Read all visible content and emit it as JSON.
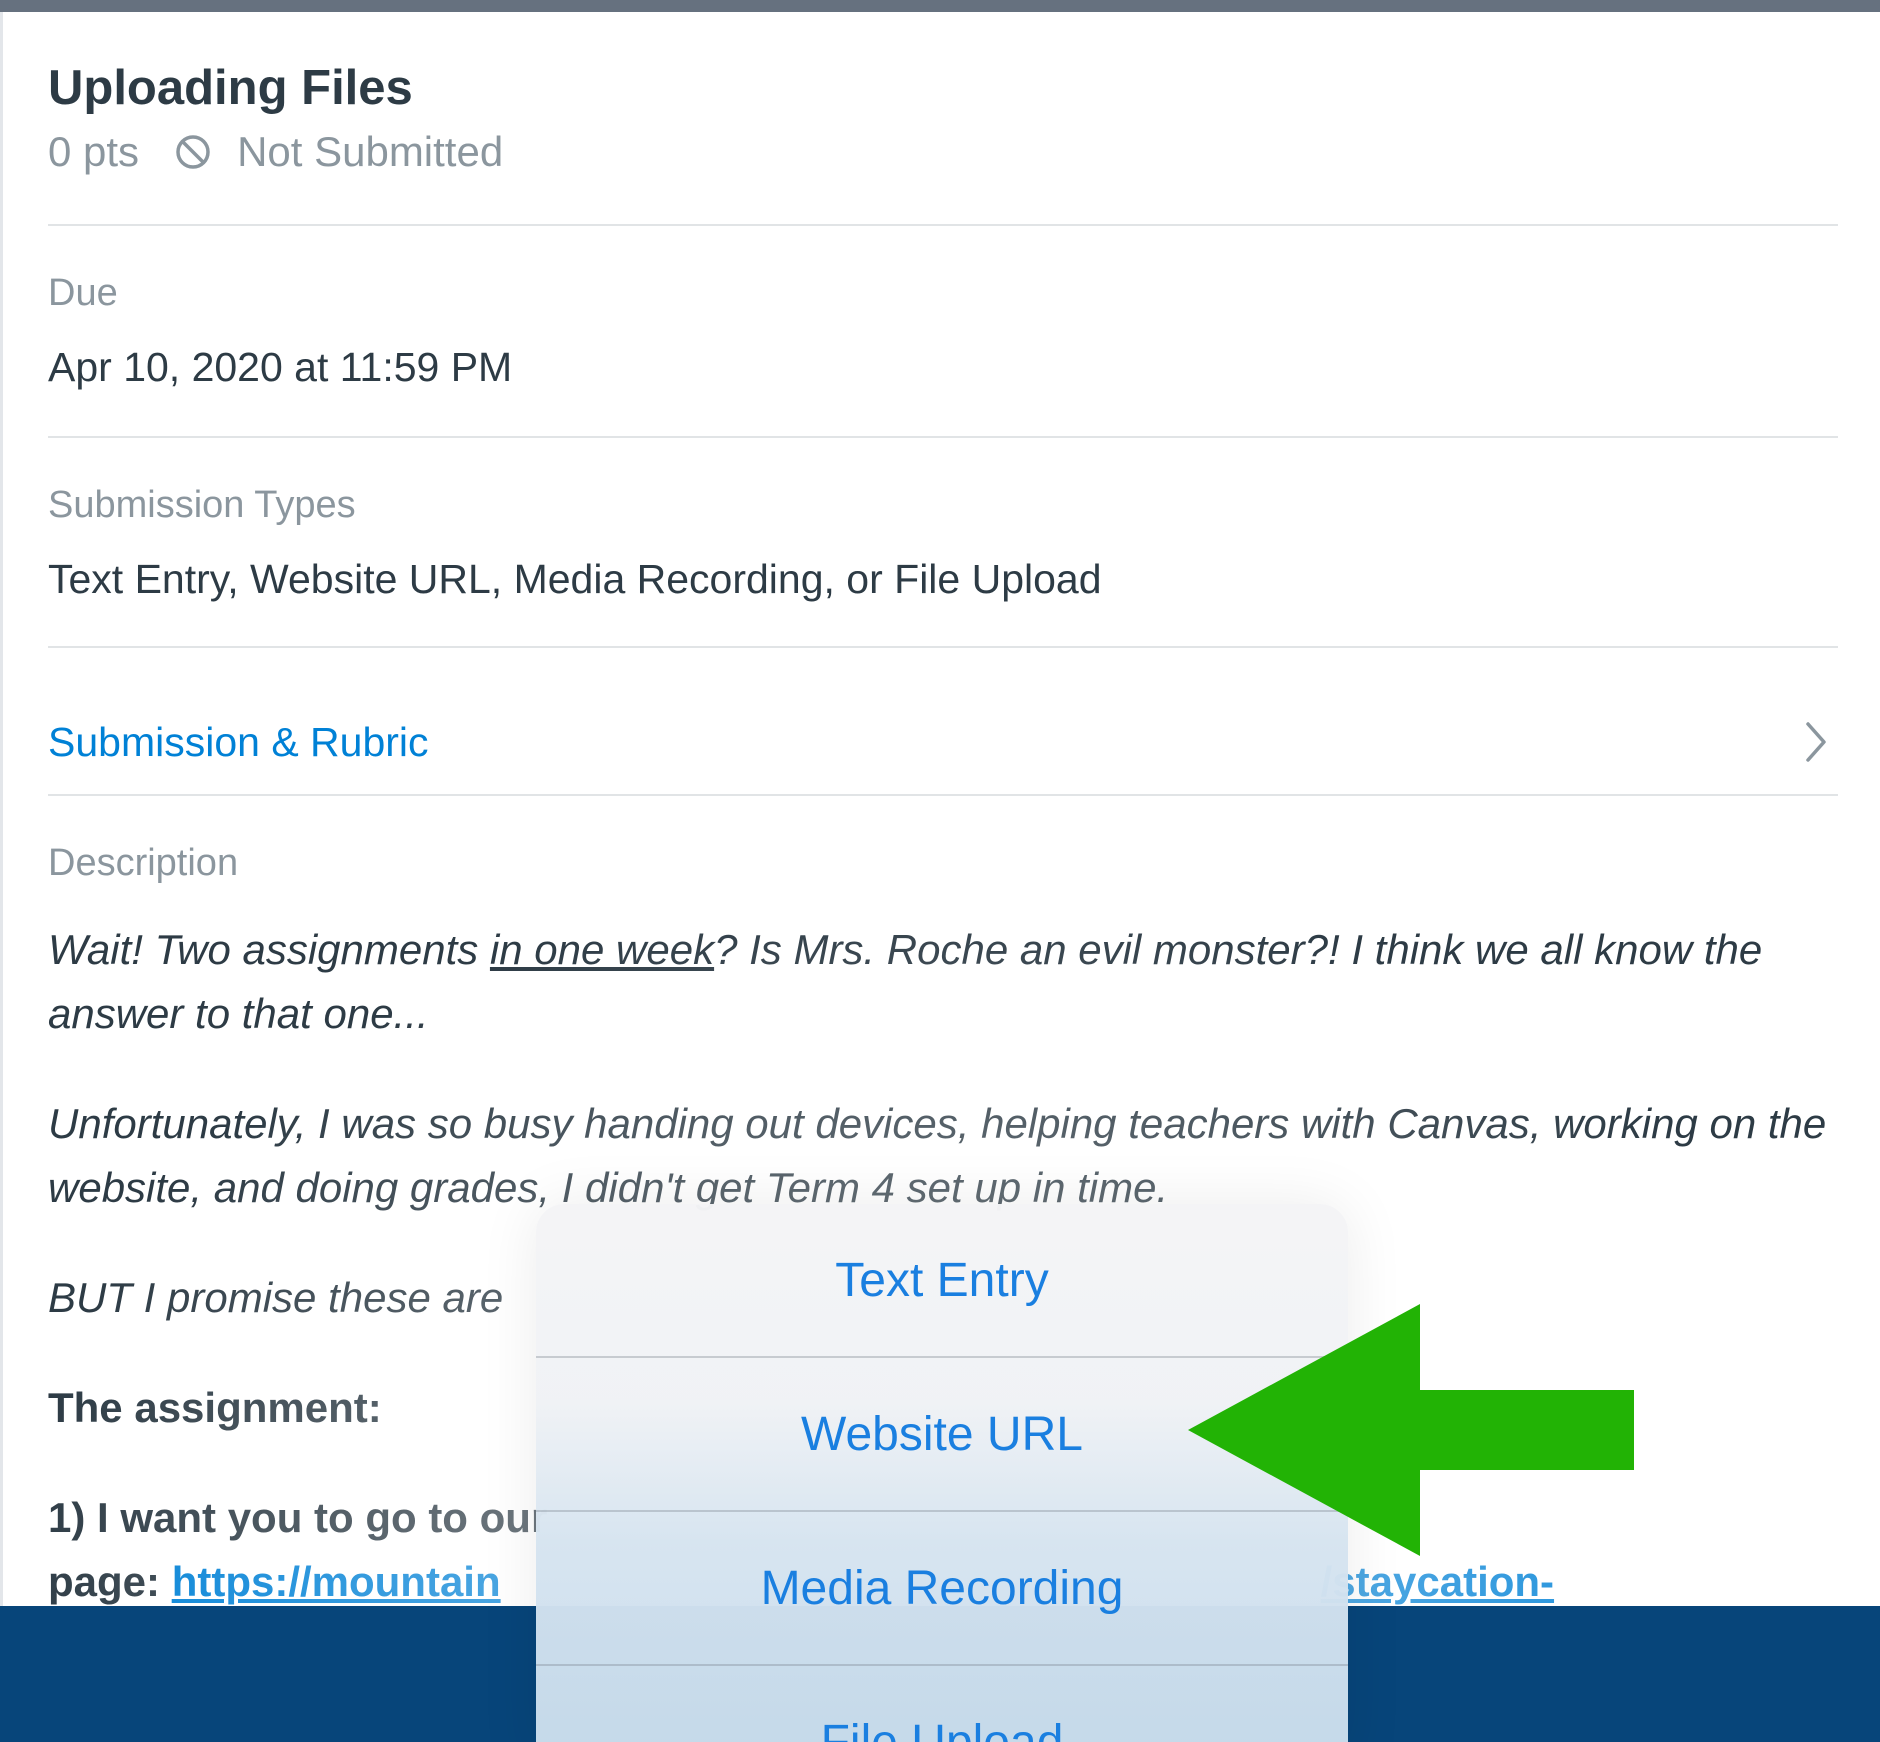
{
  "assignment": {
    "title": "Uploading Files",
    "points": "0 pts",
    "status": "Not Submitted",
    "status_icon": "ban-icon"
  },
  "due": {
    "label": "Due",
    "value": "Apr 10, 2020 at 11:59 PM"
  },
  "submission_types": {
    "label": "Submission Types",
    "value": "Text Entry, Website URL, Media Recording, or File Upload"
  },
  "submission_rubric": {
    "label": "Submission & Rubric",
    "icon": "chevron-right-icon"
  },
  "description": {
    "label": "Description",
    "p1_a": "Wait! Two assignments ",
    "p1_u": "in one week",
    "p1_b": "? Is Mrs. Roche an evil monster?! I think we all know the answer to that one...",
    "p2": "Unfortunately, I was so busy handing out devices, helping teachers with Canvas, working on the website, and doing grades, I didn't get Term 4 set up in time.",
    "p3": "BUT I promise these are",
    "p4": "The assignment:",
    "p5": "1) I want you to go to our",
    "p5_page": "page: ",
    "p5_link": "https://mountain",
    "p5_link_tail": "/staycation-"
  },
  "action_sheet": {
    "items": [
      "Text Entry",
      "Website URL",
      "Media Recording",
      "File Upload"
    ]
  },
  "colors": {
    "link": "#0081d6",
    "sheet_text": "#1a7fe0",
    "arrow": "#22b305",
    "bottom_bar": "#07457a"
  }
}
